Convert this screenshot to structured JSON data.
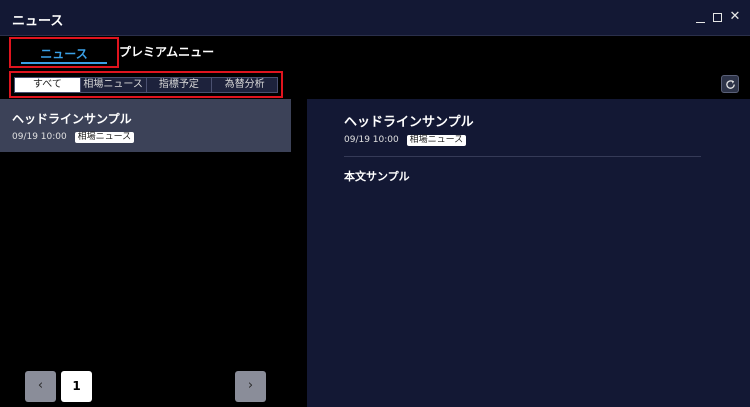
{
  "window": {
    "title": "ニュース"
  },
  "tabs": [
    {
      "label": "ニュース",
      "active": true
    },
    {
      "label": "プレミアムニュース",
      "active": false
    }
  ],
  "filters": [
    {
      "label": "すべて",
      "active": true
    },
    {
      "label": "相場ニュース",
      "active": false
    },
    {
      "label": "指標予定",
      "active": false
    },
    {
      "label": "為替分析",
      "active": false
    }
  ],
  "news_list": [
    {
      "headline": "ヘッドラインサンプル",
      "datetime": "09/19 10:00",
      "category": "相場ニュース"
    }
  ],
  "pagination": {
    "prev": "‹",
    "current_page": "1",
    "next": "›"
  },
  "detail": {
    "headline": "ヘッドラインサンプル",
    "datetime": "09/19 10:00",
    "category": "相場ニュース",
    "body": "本文サンプル"
  },
  "icons": {
    "minimize": "minimize-icon",
    "maximize": "maximize-icon",
    "close": "close-icon",
    "refresh": "refresh-icon"
  },
  "colors": {
    "accent_blue": "#3aa0e6",
    "highlight_red": "#e0141e",
    "panel_navy": "#131834",
    "selected_item": "#3c4258"
  }
}
